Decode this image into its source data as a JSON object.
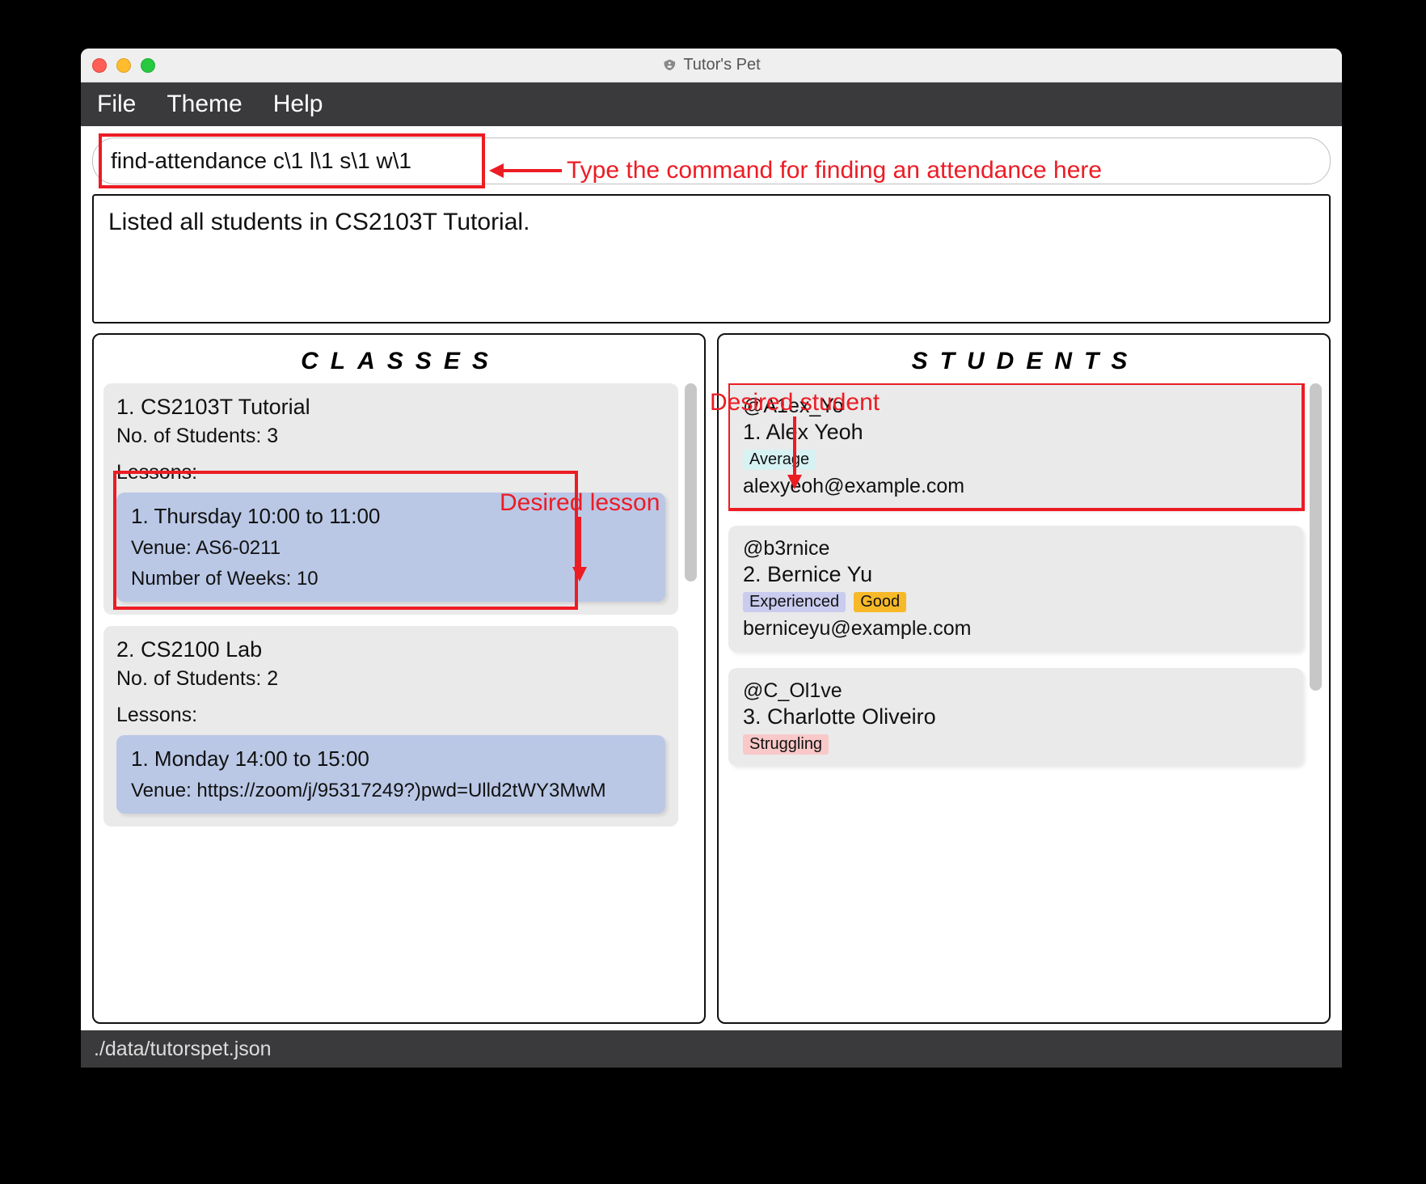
{
  "window": {
    "title": "Tutor's Pet"
  },
  "menubar": {
    "file": "File",
    "theme": "Theme",
    "help": "Help"
  },
  "command": {
    "value": "find-attendance c\\1 l\\1 s\\1 w\\1"
  },
  "result": {
    "text": "Listed all students in CS2103T Tutorial."
  },
  "panels": {
    "classes": {
      "title": "CLASSES",
      "items": [
        {
          "heading": "1.  CS2103T Tutorial",
          "count": "No. of Students:  3",
          "lessons_label": "Lessons:",
          "lessons": [
            {
              "title": "1. Thursday 10:00 to 11:00",
              "venue": "Venue: AS6-0211",
              "weeks": "Number of Weeks: 10"
            }
          ]
        },
        {
          "heading": "2.  CS2100 Lab",
          "count": "No. of Students:  2",
          "lessons_label": "Lessons:",
          "lessons": [
            {
              "title": "1. Monday 14:00 to 15:00",
              "venue": "Venue: https://zoom/j/95317249?)pwd=Ulld2tWY3MwM",
              "weeks": ""
            }
          ]
        }
      ]
    },
    "students": {
      "title": "STUDENTS",
      "items": [
        {
          "handle": "@A1ex_Yo",
          "name": "1.  Alex Yeoh",
          "tags": [
            {
              "text": "Average",
              "bg": "#d7f2f3",
              "fg": "#111"
            }
          ],
          "email": "alexyeoh@example.com"
        },
        {
          "handle": "@b3rnice",
          "name": "2.  Bernice Yu",
          "tags": [
            {
              "text": "Experienced",
              "bg": "#c9ccee",
              "fg": "#111"
            },
            {
              "text": "Good",
              "bg": "#f7b928",
              "fg": "#111"
            }
          ],
          "email": "berniceyu@example.com"
        },
        {
          "handle": "@C_Ol1ve",
          "name": "3.  Charlotte Oliveiro",
          "tags": [
            {
              "text": "Struggling",
              "bg": "#f9c8c9",
              "fg": "#111"
            }
          ],
          "email": ""
        }
      ]
    }
  },
  "statusbar": {
    "path": "./data/tutorspet.json"
  },
  "annotations": {
    "cmd_hint": "Type the command for finding an attendance here",
    "lesson_hint": "Desired lesson",
    "student_hint": "Desired student"
  },
  "colors": {
    "highlight": "#ec1c24",
    "lesson_bg": "#bac8e6",
    "card_bg": "#eaeaea"
  }
}
